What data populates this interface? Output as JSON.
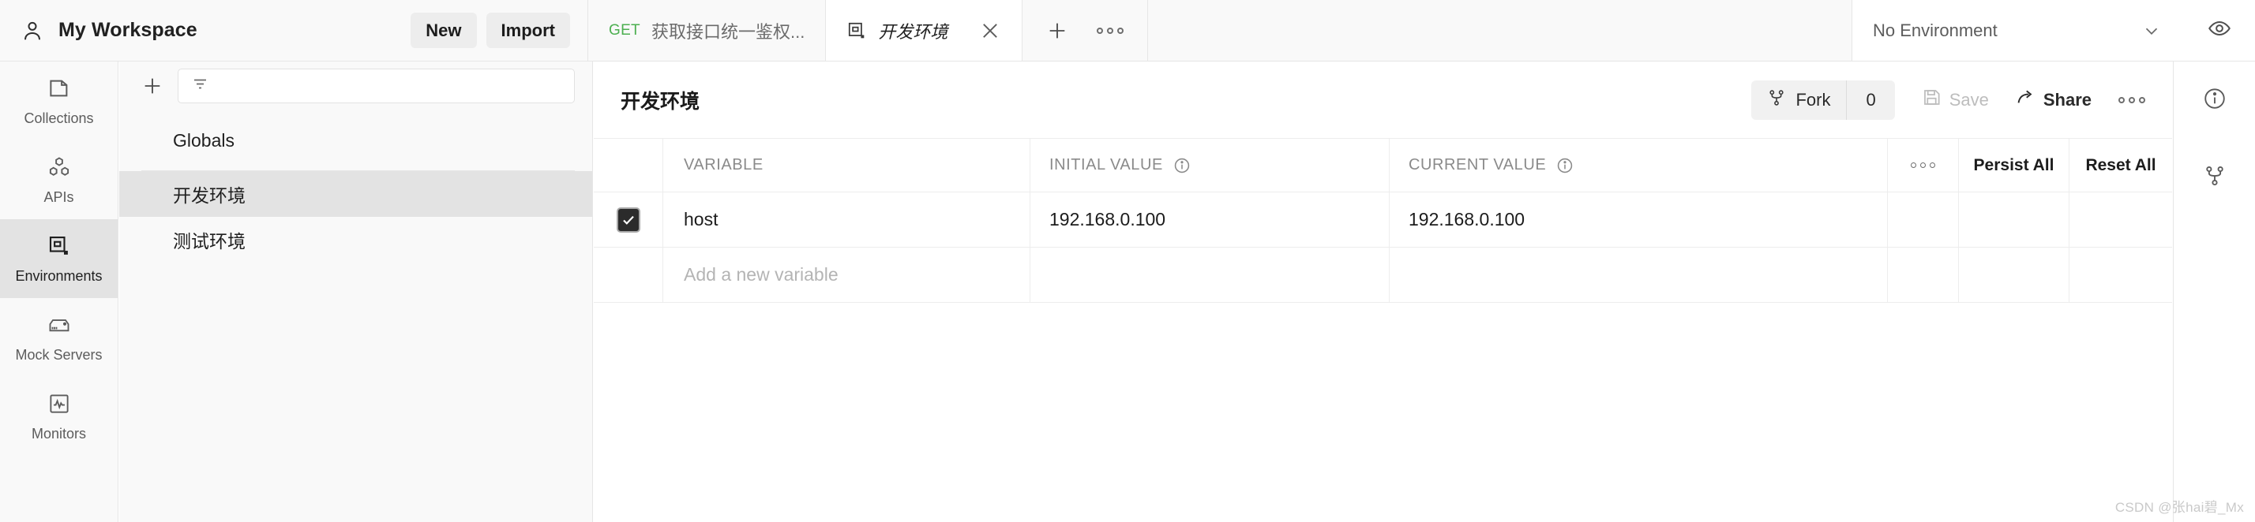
{
  "topbar": {
    "workspace_name": "My Workspace",
    "new_label": "New",
    "import_label": "Import",
    "env_selector_value": "No Environment"
  },
  "tabs": [
    {
      "method": "GET",
      "label": "获取接口统一鉴权...",
      "active": false
    },
    {
      "method": "",
      "label": "开发环境",
      "active": true
    }
  ],
  "sidebar": {
    "items": [
      {
        "label": "Collections",
        "icon": "collections-icon",
        "active": false
      },
      {
        "label": "APIs",
        "icon": "apis-icon",
        "active": false
      },
      {
        "label": "Environments",
        "icon": "environments-icon",
        "active": true
      },
      {
        "label": "Mock Servers",
        "icon": "mock-servers-icon",
        "active": false
      },
      {
        "label": "Monitors",
        "icon": "monitors-icon",
        "active": false
      }
    ]
  },
  "env_panel": {
    "filter_placeholder": "",
    "globals_label": "Globals",
    "environments": [
      {
        "label": "开发环境",
        "selected": true
      },
      {
        "label": "测试环境",
        "selected": false
      }
    ]
  },
  "main": {
    "title": "开发环境",
    "fork_label": "Fork",
    "fork_count": "0",
    "save_label": "Save",
    "share_label": "Share",
    "table": {
      "headers": {
        "variable": "VARIABLE",
        "initial_value": "INITIAL VALUE",
        "current_value": "CURRENT VALUE",
        "persist_all": "Persist All",
        "reset_all": "Reset All"
      },
      "rows": [
        {
          "checked": true,
          "variable": "host",
          "initial_value": "192.168.0.100",
          "current_value": "192.168.0.100"
        }
      ],
      "add_row_placeholder": "Add a new variable"
    }
  },
  "right_rail": {
    "items": [
      {
        "icon": "info-circle-icon"
      },
      {
        "icon": "fork-branch-icon"
      }
    ]
  },
  "watermark": "CSDN @张hai碧_Mx",
  "colors": {
    "accent_green": "#4caf50",
    "selected_bg": "#e3e3e3",
    "panel_bg": "#f9f9f9",
    "border": "#e6e6e6"
  }
}
